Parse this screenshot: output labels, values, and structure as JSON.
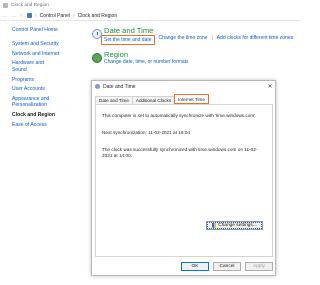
{
  "window": {
    "title": "Clock and Region"
  },
  "address": {
    "crumbs": [
      "Control Panel",
      "Clock and Region"
    ]
  },
  "sidebar": {
    "home": "Control Panel Home",
    "items": [
      {
        "label": "System and Security"
      },
      {
        "label": "Network and Internet"
      },
      {
        "label": "Hardware and Sound"
      },
      {
        "label": "Programs"
      },
      {
        "label": "User Accounts"
      },
      {
        "label": "Appearance and Personalization"
      },
      {
        "label": "Clock and Region"
      },
      {
        "label": "Ease of Access"
      }
    ],
    "selected_index": 6
  },
  "sections": [
    {
      "title": "Date and Time",
      "icon": "clock-icon",
      "links": [
        "Set the time and date",
        "Change the time zone",
        "Add clocks for different time zones"
      ]
    },
    {
      "title": "Region",
      "icon": "globe-icon",
      "links": [
        "Change date, time, or number formats"
      ]
    }
  ],
  "dialog": {
    "title": "Date and Time",
    "close": "✕",
    "tabs": [
      "Date and Time",
      "Additional Clocks",
      "Internet Time"
    ],
    "active_tab": "Internet Time",
    "messages": [
      "This computer is set to automatically synchronize with 'time.windows.com'.",
      "Next synchronization: 11-02-2021 at 18:04",
      "The clock was successfully synchronized with time.windows.com on 11-02-2021 at 14:00."
    ],
    "change_button": "Change settings...",
    "buttons": {
      "ok": "OK",
      "cancel": "Cancel",
      "apply": "Apply"
    }
  },
  "colors": {
    "link": "#0b5ec9",
    "heading": "#19933e",
    "highlight": "#e5712c"
  }
}
